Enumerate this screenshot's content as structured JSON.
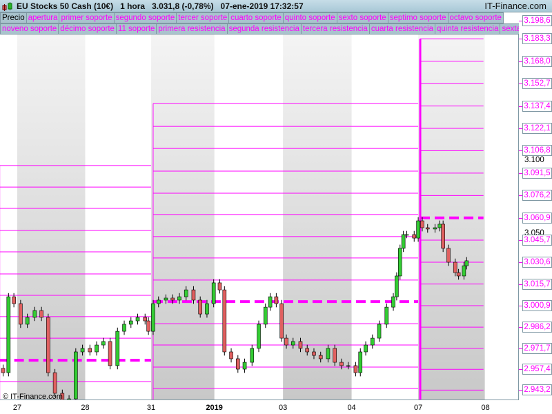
{
  "header": {
    "instrument": "EU Stocks 50 Cash (10€)",
    "timeframe": "1 hora",
    "price": "3.031,8",
    "change": "(-0,78%)",
    "datetime": "07-ene-2019 17:32:57",
    "brand": "IT-Finance.com"
  },
  "indicators_row1": [
    "Precio",
    "apertura",
    "primer soporte",
    "segundo soporte",
    "tercer soporte",
    "cuarto soporte",
    "quinto soporte",
    "sexto soporte",
    "septimo soporte",
    "octavo soporte"
  ],
  "indicators_row2": [
    "noveno soporte",
    "décimo soporte",
    "11 soporte",
    "primera resistencia",
    "segunda resistencia",
    "tercera resistencia",
    "cuarta resistencia",
    "quinta resistencia",
    "sexta resistencia"
  ],
  "watermark": "© IT-Finance.com",
  "colors": {
    "up": "#33cc33",
    "down": "#e06060",
    "pivot": "#ff00ff"
  },
  "chart_data": {
    "type": "candlestick",
    "title": "EU Stocks 50 Cash (10€) 1 hora",
    "ylim": [
      2930,
      3200
    ],
    "price_labels": [
      "3.198,6",
      "3.183,3",
      "3.168,0",
      "3.152,7",
      "3.137,4",
      "3.122,1",
      "3.106,8",
      "3.091,5",
      "3.076,2",
      "3.060,9",
      "3.045,7",
      "3.030,6",
      "3.015,7",
      "3.000,9",
      "2.986,2",
      "2.971,7",
      "2.957,4",
      "2.943,2"
    ],
    "price_label_values": [
      3198.6,
      3183.3,
      3168.0,
      3152.7,
      3137.4,
      3122.1,
      3106.8,
      3091.5,
      3076.2,
      3060.9,
      3045.7,
      3030.6,
      3015.7,
      3000.9,
      2986.2,
      2971.7,
      2957.4,
      2943.2
    ],
    "axis_ticks": [
      {
        "label": "3.100",
        "value": 3100
      },
      {
        "label": "3.050",
        "value": 3050
      }
    ],
    "x_ticks": [
      {
        "label": "27",
        "d": 0
      },
      {
        "label": "28",
        "d": 1.01
      },
      {
        "label": "31",
        "d": 1.99
      },
      {
        "label": "2019",
        "d": 2.93,
        "bold": true
      },
      {
        "label": "03",
        "d": 3.95
      },
      {
        "label": "04",
        "d": 4.97
      },
      {
        "label": "07",
        "d": 5.96
      },
      {
        "label": "08",
        "d": 6.96
      }
    ],
    "shaded_days": [
      [
        0,
        1.01
      ],
      [
        1.99,
        2.93
      ],
      [
        3.95,
        4.97
      ],
      [
        5.96,
        6.95
      ]
    ],
    "pivot_segments": [
      {
        "from": -0.26,
        "to": 1.99,
        "pivot": 2963.6,
        "levels": [
          3096.7,
          3082.0,
          3067.4,
          3052.3,
          3037.7,
          3022.6,
          3008.0,
          2993.4,
          2978.7,
          2963.6,
          2949.0
        ]
      },
      {
        "from": 2.02,
        "to": 5.96,
        "pivot": 3003.7,
        "levels": [
          3139.1,
          3123.5,
          3108.4,
          3092.9,
          3077.8,
          3063.2,
          3048.1,
          3033.5,
          3018.4,
          3003.7,
          2988.6,
          2974.0,
          2958.9,
          2944.3
        ]
      },
      {
        "from": 5.99,
        "to": 6.93,
        "pivot": 3060.9,
        "levels": [
          3183.3,
          3168.0,
          3152.7,
          3137.4,
          3122.1,
          3106.8,
          3091.5,
          3076.2,
          3060.9,
          3045.7,
          3030.6,
          3015.7,
          3000.9,
          2986.2,
          2971.7,
          2957.4,
          2943.2
        ]
      }
    ],
    "closes": [
      [
        -0.21,
        2955.1
      ],
      [
        -0.13,
        3007.0
      ],
      [
        -0.05,
        3002.3
      ],
      [
        0.05,
        2988.2
      ],
      [
        0.15,
        2992.9
      ],
      [
        0.26,
        2997.6
      ],
      [
        0.36,
        2992.9
      ],
      [
        0.46,
        2955.1
      ],
      [
        0.56,
        2941.0
      ],
      [
        0.67,
        2936.3
      ],
      [
        0.77,
        2937.2
      ],
      [
        0.87,
        2969.3
      ],
      [
        0.97,
        2971.7
      ],
      [
        1.08,
        2969.3
      ],
      [
        1.18,
        2974.0
      ],
      [
        1.28,
        2976.4
      ],
      [
        1.38,
        2959.9
      ],
      [
        1.49,
        2983.4
      ],
      [
        1.59,
        2988.2
      ],
      [
        1.69,
        2990.5
      ],
      [
        1.79,
        2992.9
      ],
      [
        1.9,
        2990.5
      ],
      [
        1.95,
        2983.4
      ],
      [
        2.02,
        3002.3
      ],
      [
        2.1,
        3004.7
      ],
      [
        2.21,
        3006.1
      ],
      [
        2.31,
        3004.7
      ],
      [
        2.41,
        3007.0
      ],
      [
        2.51,
        3011.7
      ],
      [
        2.62,
        3004.7
      ],
      [
        2.72,
        2995.2
      ],
      [
        2.82,
        3002.3
      ],
      [
        2.92,
        3016.5
      ],
      [
        3.01,
        3011.7
      ],
      [
        3.08,
        2969.3
      ],
      [
        3.18,
        2964.6
      ],
      [
        3.28,
        2957.5
      ],
      [
        3.38,
        2962.2
      ],
      [
        3.49,
        2971.7
      ],
      [
        3.59,
        2988.2
      ],
      [
        3.69,
        2999.9
      ],
      [
        3.76,
        3007.0
      ],
      [
        3.85,
        3002.3
      ],
      [
        3.93,
        2978.7
      ],
      [
        4.0,
        2974.0
      ],
      [
        4.1,
        2976.4
      ],
      [
        4.21,
        2971.7
      ],
      [
        4.31,
        2969.3
      ],
      [
        4.41,
        2966.9
      ],
      [
        4.51,
        2964.6
      ],
      [
        4.62,
        2971.7
      ],
      [
        4.72,
        2962.2
      ],
      [
        4.82,
        2959.9
      ],
      [
        4.92,
        2959.9
      ],
      [
        5.03,
        2955.1
      ],
      [
        5.1,
        2969.3
      ],
      [
        5.18,
        2974.0
      ],
      [
        5.28,
        2978.7
      ],
      [
        5.38,
        2988.2
      ],
      [
        5.49,
        2999.9
      ],
      [
        5.59,
        3007.0
      ],
      [
        5.64,
        3021.2
      ],
      [
        5.69,
        3040.1
      ],
      [
        5.74,
        3049.5
      ],
      [
        5.79,
        3049.5
      ],
      [
        5.9,
        3047.1
      ],
      [
        5.96,
        3058.9
      ],
      [
        6.02,
        3054.2
      ],
      [
        6.1,
        3053.3
      ],
      [
        6.21,
        3054.2
      ],
      [
        6.28,
        3056.6
      ],
      [
        6.33,
        3040.1
      ],
      [
        6.41,
        3030.6
      ],
      [
        6.51,
        3023.5
      ],
      [
        6.56,
        3021.2
      ],
      [
        6.64,
        3028.2
      ],
      [
        6.68,
        3031.6
      ]
    ]
  }
}
